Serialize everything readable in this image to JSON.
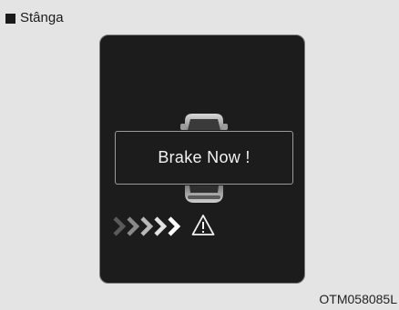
{
  "section": {
    "title": "Stânga"
  },
  "display": {
    "message": "Brake Now !",
    "icons": {
      "vehicle": "vehicle-top-view-icon",
      "approach": "approach-chevrons-icon",
      "warning": "warning-triangle-icon"
    },
    "colors": {
      "panel": "#1c1c1c",
      "text": "#f2f2f2",
      "border": "#9a9a9a"
    }
  },
  "figure": {
    "code": "OTM058085L"
  }
}
